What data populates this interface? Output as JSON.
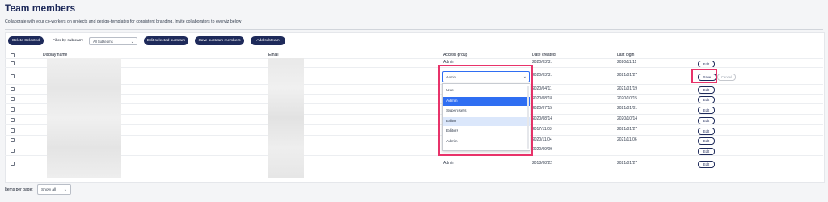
{
  "page": {
    "title": "Team members",
    "subtitle": "Collaborate with your co-workers on projects and design-templates for consistent branding. Invite collaborators to everviz below"
  },
  "toolbar": {
    "delete_label": "Delete Selected",
    "filter_label": "Filter by subteam:",
    "filter_value": "All Subteams",
    "edit_subteam_label": "Edit selected subteam",
    "save_members_label": "Save subteam members",
    "add_subteam_label": "Add subteam"
  },
  "table": {
    "headers": {
      "display_name": "Display name",
      "email": "Email",
      "access_group": "Access group",
      "date_created": "Date created",
      "last_login": "Last login"
    },
    "rows": [
      {
        "group": "Admin",
        "created": "2020/03/31",
        "login": "2020/11/11",
        "action": "Edit"
      },
      {
        "group": "Admin",
        "created": "2020/03/31",
        "login": "2021/01/27",
        "action": "Save",
        "secondary": "Cancel",
        "editing": true
      },
      {
        "group": "",
        "created": "2020/04/11",
        "login": "2021/01/19",
        "action": "Edit"
      },
      {
        "group": "",
        "created": "2020/08/18",
        "login": "2020/10/15",
        "action": "Edit"
      },
      {
        "group": "",
        "created": "2020/07/15",
        "login": "2021/01/01",
        "action": "Edit"
      },
      {
        "group": "",
        "created": "2020/08/14",
        "login": "2020/10/14",
        "action": "Edit"
      },
      {
        "group": "",
        "created": "2017/11/03",
        "login": "2021/01/27",
        "action": "Edit"
      },
      {
        "group": "",
        "created": "2020/11/04",
        "login": "2021/11/06",
        "action": "Edit"
      },
      {
        "group": "Admin",
        "created": "2020/09/09",
        "login": "---",
        "action": "Edit"
      },
      {
        "group": "Admin",
        "created": "2018/08/22",
        "login": "2021/01/27",
        "action": "Edit"
      }
    ]
  },
  "dropdown": {
    "options": [
      "User",
      "Admin",
      "Superusers",
      "Editor",
      "Editors",
      "Admin"
    ]
  },
  "footer": {
    "items_label": "Items per page:",
    "items_value": "Show all"
  },
  "colors": {
    "brand": "#1e2a5a",
    "highlight": "#e8336a",
    "selected": "#2f6ef2",
    "hover": "#dbe7fb"
  }
}
